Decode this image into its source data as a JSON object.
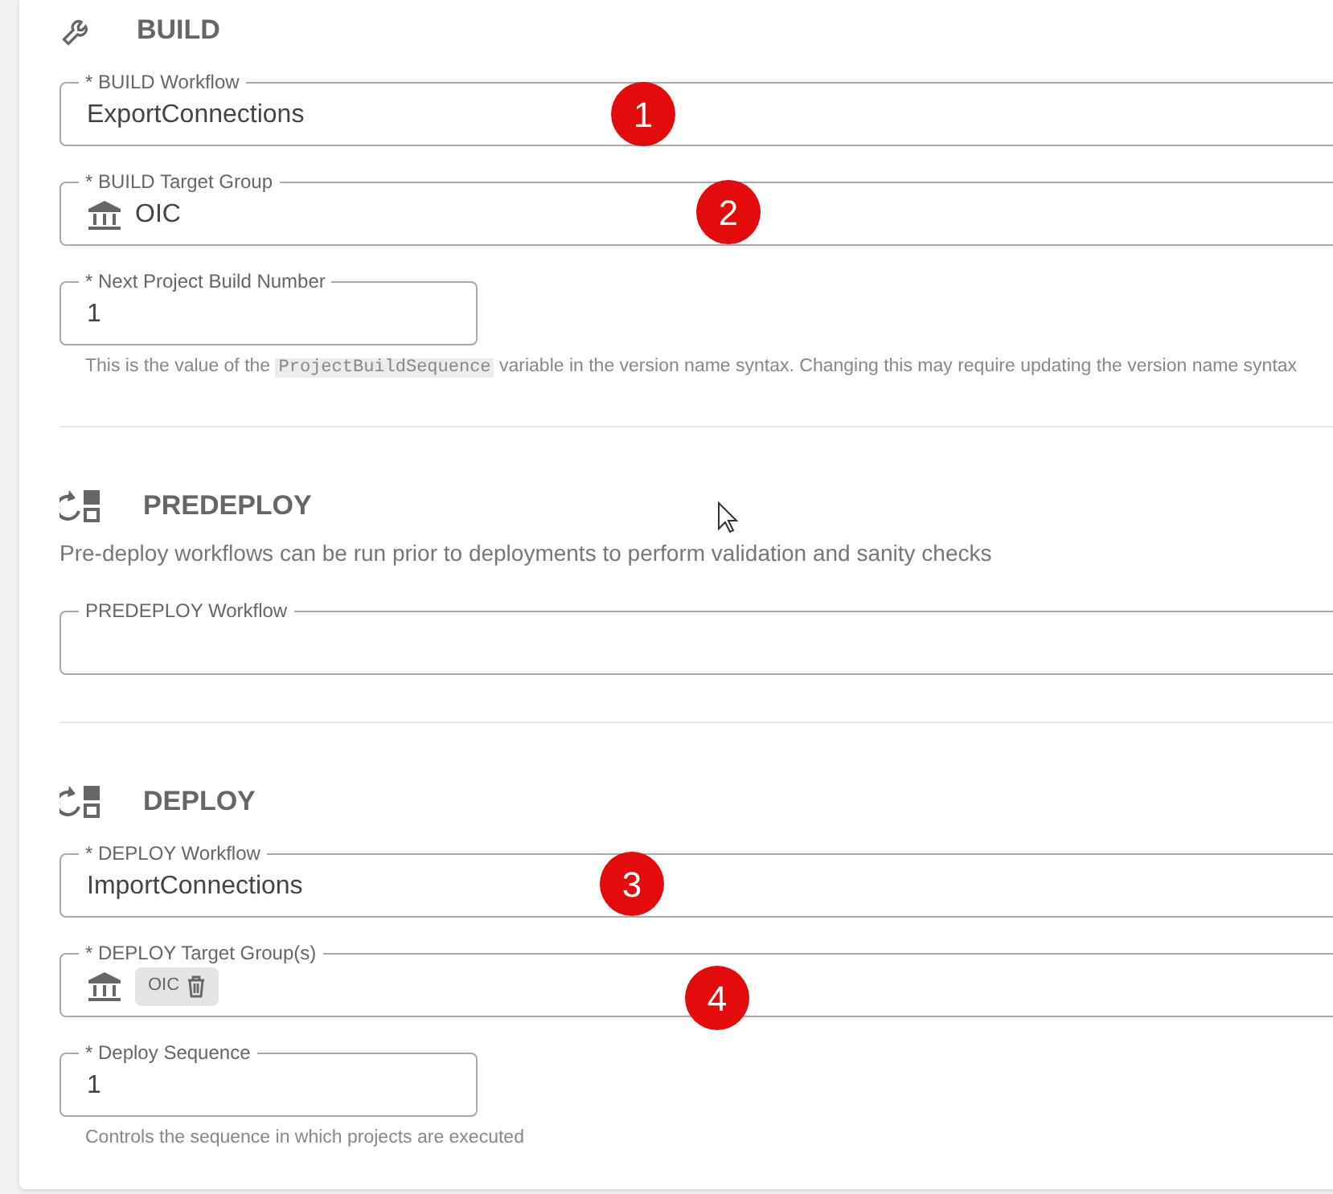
{
  "sections": [
    {
      "title": "BUILD",
      "fields": [
        {
          "kind": "text",
          "label": "* BUILD Workflow",
          "value": "ExportConnections",
          "callout": "1"
        },
        {
          "kind": "group",
          "label": "* BUILD Target Group",
          "value": "OIC",
          "callout": "2"
        },
        {
          "kind": "number",
          "label": "* Next Project Build Number",
          "value": "1",
          "helper": [
            {
              "kind": "text",
              "text": "This is the value of the "
            },
            {
              "kind": "code",
              "text": "ProjectBuildSequence"
            },
            {
              "kind": "text",
              "text": " variable in the version name syntax. Changing this may require updating the version name syntax"
            }
          ]
        }
      ]
    },
    {
      "title": "PREDEPLOY",
      "description": "Pre-deploy workflows can be run prior to deployments to perform validation and sanity checks",
      "fields": [
        {
          "kind": "text",
          "label": "PREDEPLOY Workflow"
        }
      ]
    },
    {
      "title": "DEPLOY",
      "fields": [
        {
          "kind": "text",
          "label": "* DEPLOY Workflow",
          "value": "ImportConnections",
          "callout": "3"
        },
        {
          "kind": "groups",
          "label": "* DEPLOY Target Group(s)",
          "chips": [
            "OIC"
          ],
          "callout": "4"
        },
        {
          "kind": "number",
          "label": "* Deploy Sequence",
          "value": "1",
          "helper": [
            {
              "kind": "text",
              "text": "Controls the sequence in which projects are executed"
            }
          ]
        }
      ]
    }
  ]
}
